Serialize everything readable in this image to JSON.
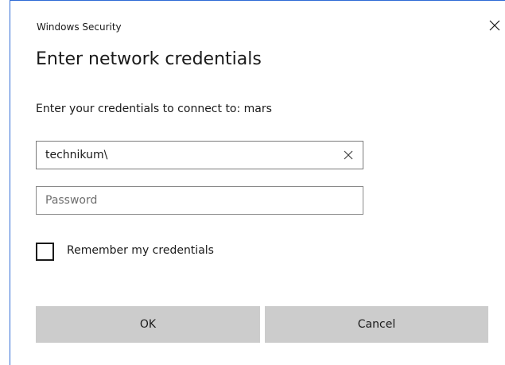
{
  "window": {
    "app_title": "Windows Security",
    "heading": "Enter network credentials",
    "subtitle": "Enter your credentials to connect to: mars"
  },
  "form": {
    "username_value": "technikum\\",
    "password_placeholder": "Password",
    "remember_label": "Remember my credentials",
    "remember_checked": false
  },
  "buttons": {
    "ok_label": "OK",
    "cancel_label": "Cancel"
  },
  "icons": {
    "close": "close-icon",
    "clear": "clear-icon"
  },
  "colors": {
    "accent_border": "#2f6bd6",
    "button_bg": "#cccccc"
  }
}
